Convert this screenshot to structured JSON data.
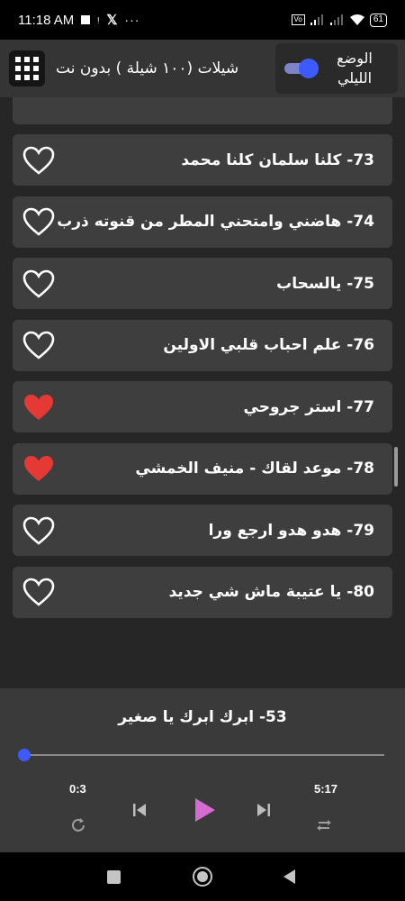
{
  "status_bar": {
    "time": "11:18 AM",
    "icons": [
      "stop-icon",
      "mic-icon",
      "x-icon",
      "more-icon"
    ],
    "right_icons": [
      "volte-icon",
      "signal-icon",
      "signal-icon",
      "wifi-icon"
    ],
    "battery": "61"
  },
  "app_bar": {
    "title": "شيلات (١٠٠ شيلة ) بدون نت",
    "night_mode_label": "الوضع الليلي",
    "night_mode_on": true,
    "grid_icon": "grid-icon"
  },
  "songs": [
    {
      "label": "73- كلنا سلمان كلنا محمد",
      "favorite": false
    },
    {
      "label": "74- هاضني وامتحني المطر من قنوته ذرب",
      "favorite": false
    },
    {
      "label": "75- يالسحاب",
      "favorite": false
    },
    {
      "label": "76- علم احباب قلبي الاولين",
      "favorite": false
    },
    {
      "label": "77- استر جروحي",
      "favorite": true
    },
    {
      "label": "78- موعد لقاك - منيف الخمشي",
      "favorite": true
    },
    {
      "label": "79- هدو هدو ارجع ورا",
      "favorite": false
    },
    {
      "label": "80- يا عتيبة ماش شي جديد",
      "favorite": false
    }
  ],
  "player": {
    "now_playing": "53- ابرك ابرك يا صغير",
    "current_time": "0:3",
    "total_time": "5:17",
    "progress": 0.0,
    "controls": [
      "previous-icon",
      "play-icon",
      "next-icon",
      "repeat-icon",
      "shuffle-icon"
    ]
  },
  "colors": {
    "accent": "#3d5afe",
    "favorite": "#e53935",
    "play": "#d56bd3",
    "item_bg": "#3e3e3e",
    "background": "#262626"
  },
  "nav": [
    "recents-icon",
    "home-icon",
    "back-icon"
  ]
}
